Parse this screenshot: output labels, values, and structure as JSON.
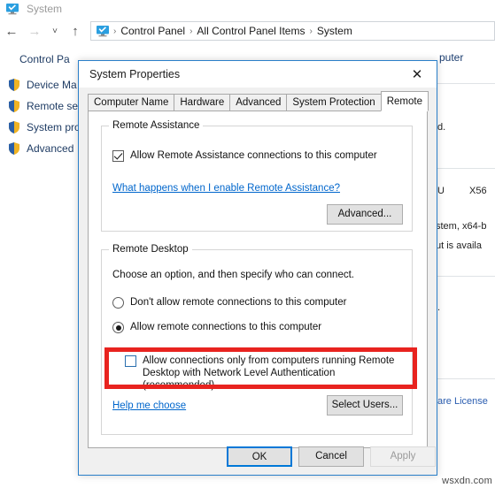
{
  "explorer": {
    "title": "System",
    "title_icon": "system-monitor-icon",
    "nav": {
      "back_icon": "back-arrow-icon",
      "forward_icon": "forward-arrow-icon",
      "recent_icon": "chevron-down-icon",
      "up_icon": "up-arrow-icon"
    },
    "breadcrumb": {
      "icon": "control-panel-monitor-icon",
      "separator": "›",
      "items": [
        "Control Panel",
        "All Control Panel Items",
        "System"
      ]
    },
    "sidebar": {
      "header": "Control Pa",
      "items": [
        {
          "icon": "shield-icon",
          "label": "Device Ma"
        },
        {
          "icon": "shield-icon",
          "label": "Remote se"
        },
        {
          "icon": "shield-icon",
          "label": "System pro"
        },
        {
          "icon": "shield-icon",
          "label": "Advanced"
        }
      ]
    },
    "background_fragments": {
      "heading": "puter",
      "line_d": "d.",
      "line_cpu": "U",
      "line_x56": "X56",
      "line_system": "stem, x64-b",
      "line_input": "ut is availa",
      "line_dot": ".",
      "link_license": "are License"
    },
    "watermark": "wsxdn.com"
  },
  "dialog": {
    "title": "System Properties",
    "close_icon": "close-icon",
    "tabs": [
      {
        "label": "Computer Name",
        "active": false
      },
      {
        "label": "Hardware",
        "active": false
      },
      {
        "label": "Advanced",
        "active": false
      },
      {
        "label": "System Protection",
        "active": false
      },
      {
        "label": "Remote",
        "active": true
      }
    ],
    "remote_assistance": {
      "group_title": "Remote Assistance",
      "checkbox_label": "Allow Remote Assistance connections to this computer",
      "checkbox_checked": true,
      "link": "What happens when I enable Remote Assistance?",
      "advanced_button": "Advanced..."
    },
    "remote_desktop": {
      "group_title": "Remote Desktop",
      "instruction": "Choose an option, and then specify who can connect.",
      "radio_options": [
        {
          "label": "Don't allow remote connections to this computer",
          "selected": false
        },
        {
          "label": "Allow remote connections to this computer",
          "selected": true
        }
      ],
      "nla_checkbox": {
        "line1": "Allow connections only from computers running Remote",
        "line2": "Desktop with Network Level Authentication (recommended)",
        "checked": false,
        "highlighted": true
      },
      "help_link": "Help me choose",
      "select_users_button": "Select Users..."
    },
    "footer": {
      "ok": "OK",
      "cancel": "Cancel",
      "apply": "Apply",
      "apply_disabled": true
    }
  },
  "colors": {
    "highlight_red": "#e8231f",
    "accent_blue": "#0078d7",
    "link_blue": "#0066cc",
    "dialog_border": "#2a7fc9"
  }
}
